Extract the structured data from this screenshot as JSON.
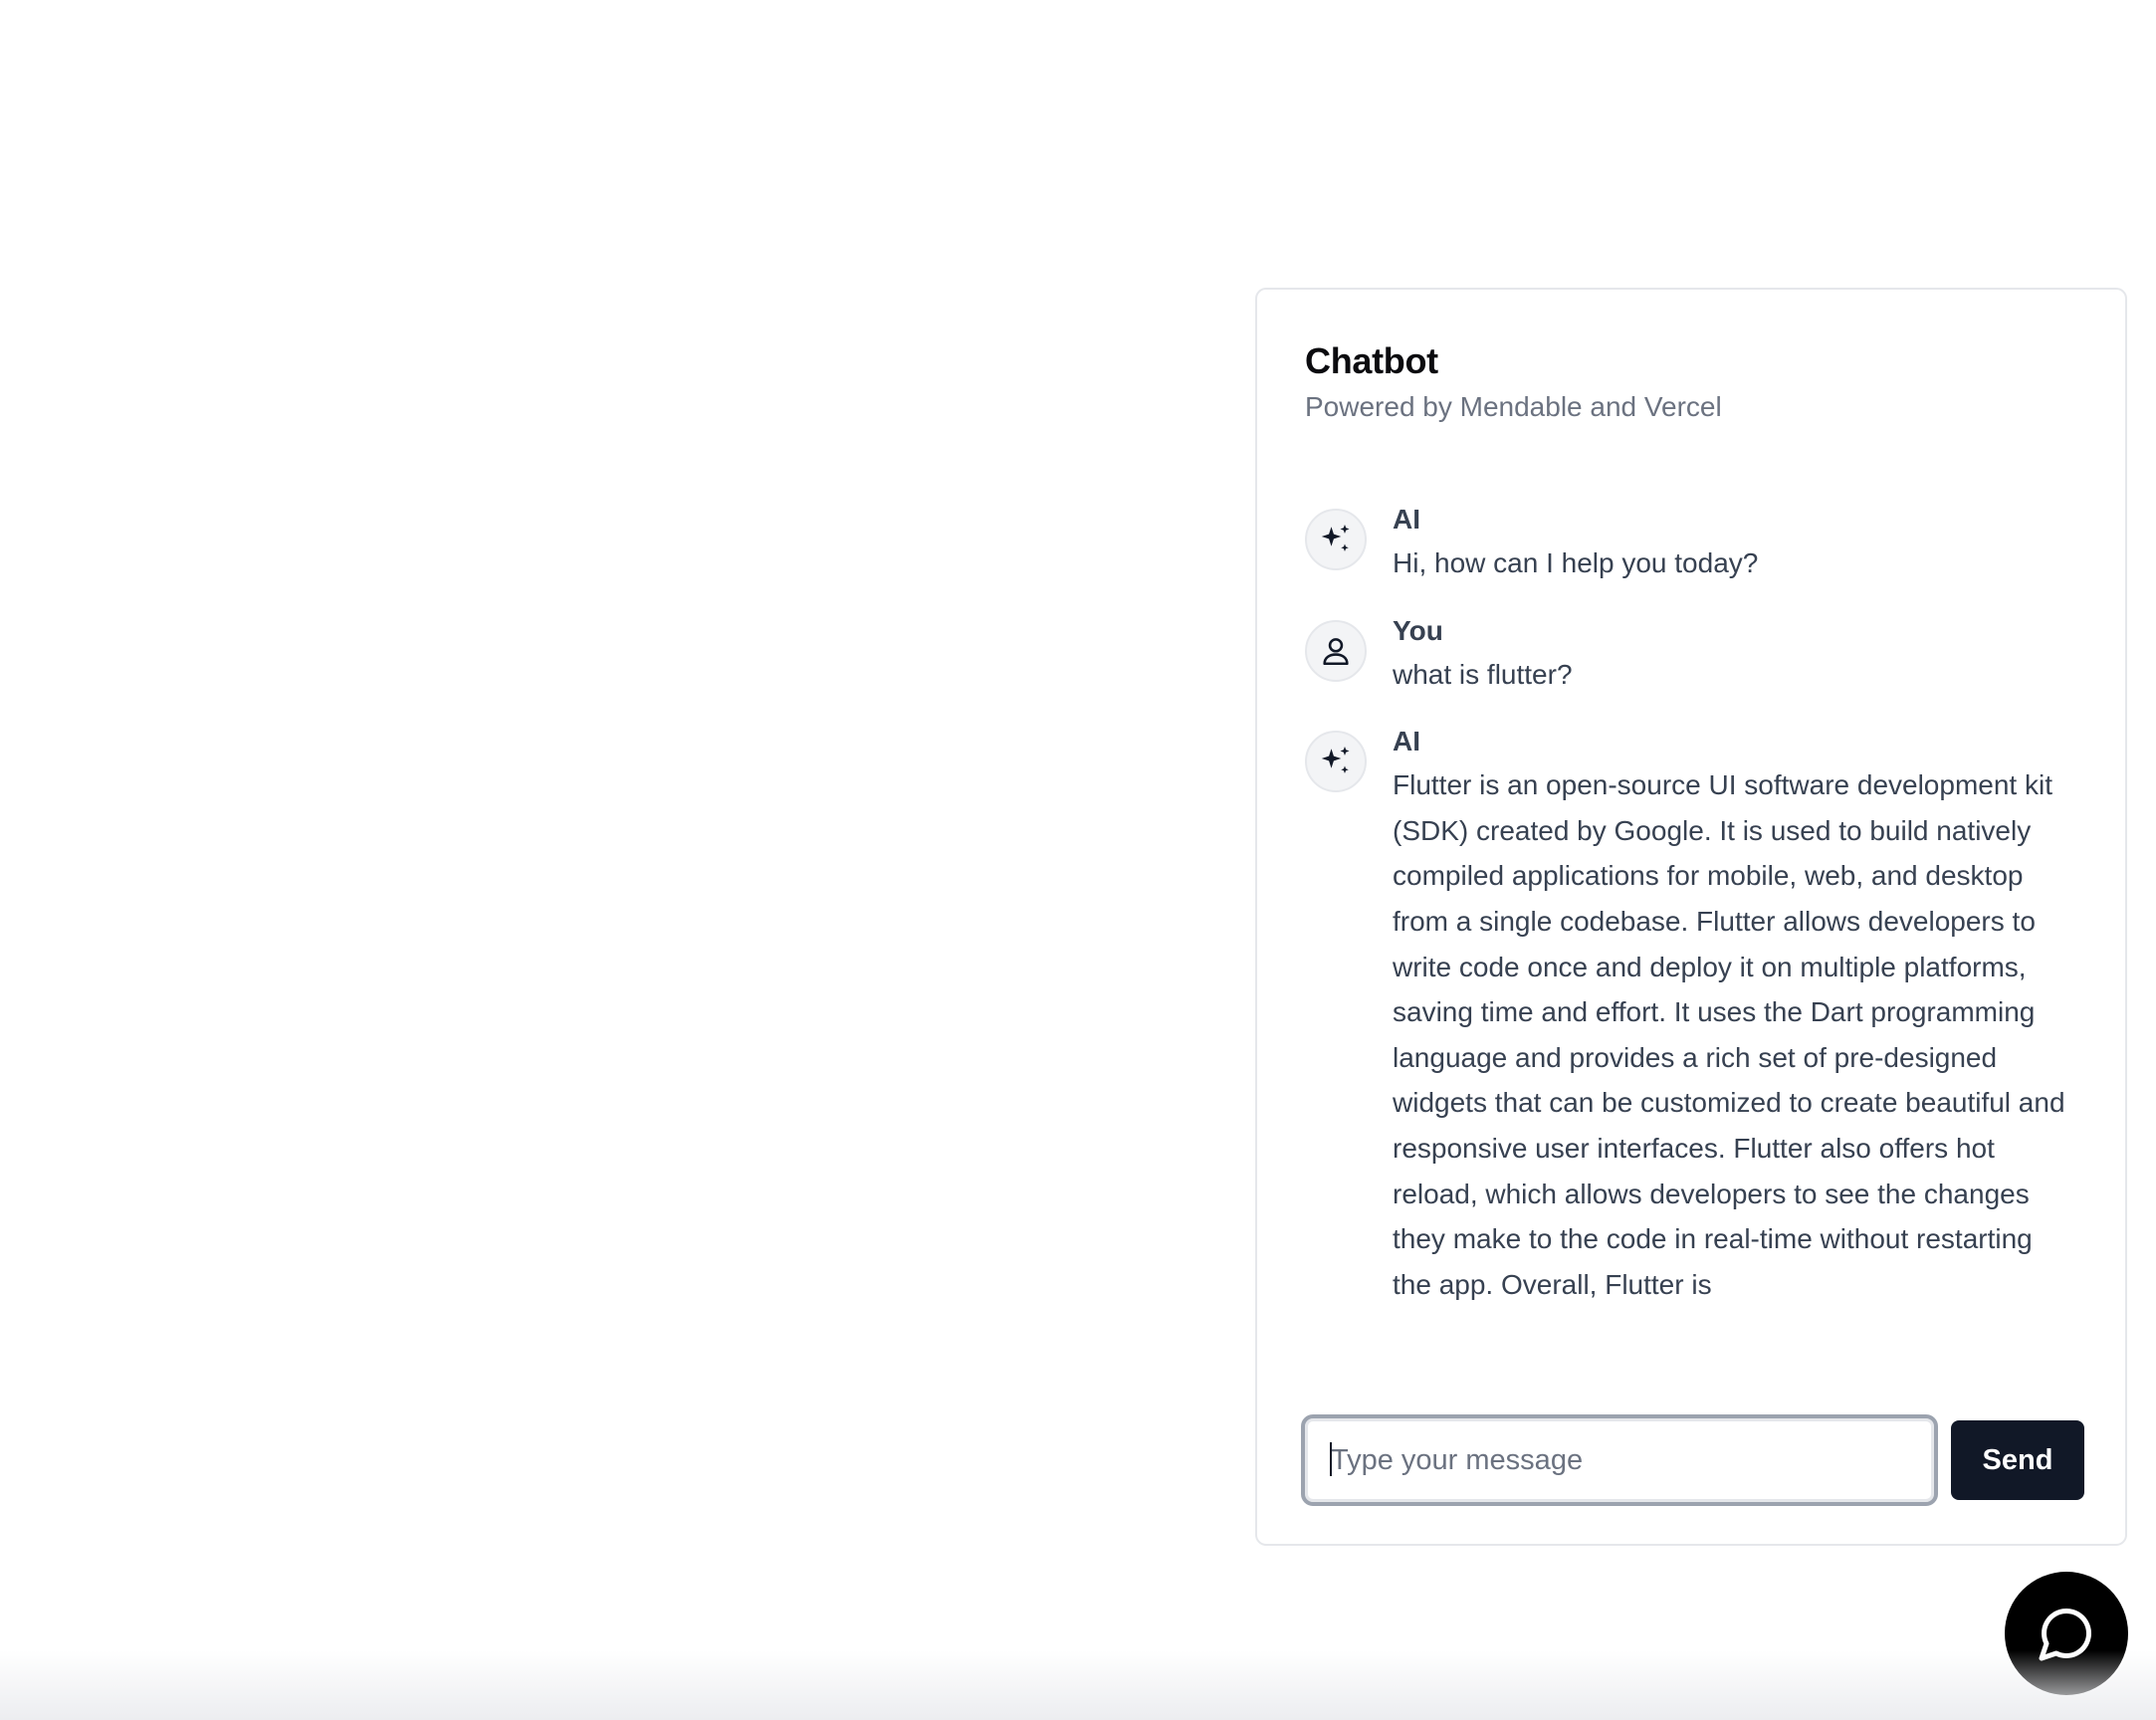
{
  "chatbot": {
    "title": "Chatbot",
    "subtitle": "Powered by Mendable and Vercel",
    "messages": [
      {
        "sender": "AI",
        "avatar_icon": "sparkles-icon",
        "text": "Hi, how can I help you today?"
      },
      {
        "sender": "You",
        "avatar_icon": "user-icon",
        "text": "what is flutter?"
      },
      {
        "sender": "AI",
        "avatar_icon": "sparkles-icon",
        "text": "Flutter is an open-source UI software development kit (SDK) created by Google. It is used to build natively compiled applications for mobile, web, and desktop from a single codebase. Flutter allows developers to write code once and deploy it on multiple platforms, saving time and effort. It uses the Dart programming language and provides a rich set of pre-designed widgets that can be customized to create beautiful and responsive user interfaces. Flutter also offers hot reload, which allows developers to see the changes they make to the code in real-time without restarting the app. Overall, Flutter is"
      }
    ],
    "input": {
      "value": "",
      "placeholder": "Type your message"
    },
    "send_label": "Send"
  },
  "launcher": {
    "icon": "chat-bubble-icon"
  },
  "colors": {
    "primary": "#111827",
    "muted_text": "#6b7280",
    "body_text": "#374151",
    "avatar_bg": "#f3f4f6",
    "border": "#e5e7eb",
    "launcher_bg": "#000000"
  }
}
